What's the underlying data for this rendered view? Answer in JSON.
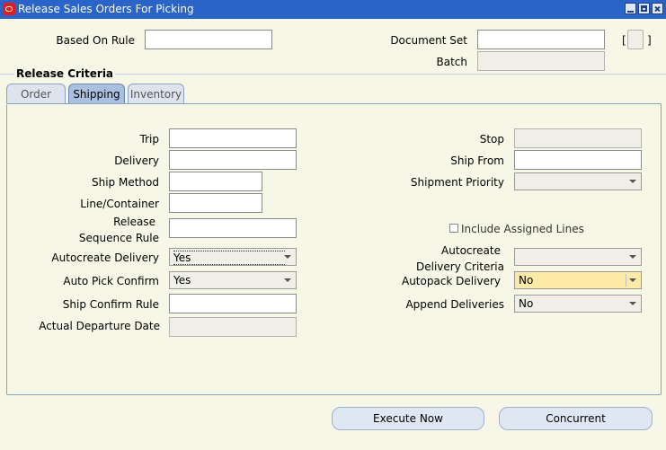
{
  "window": {
    "title": "Release Sales Orders For Picking"
  },
  "header": {
    "based_on_rule_label": "Based On Rule",
    "based_on_rule_value": "",
    "document_set_label": "Document Set",
    "document_set_value": "",
    "batch_label": "Batch",
    "batch_value": "",
    "bracket_left": "[",
    "bracket_right": "]"
  },
  "release_criteria": {
    "title": "Release Criteria",
    "tabs": [
      {
        "label": "Order"
      },
      {
        "label": "Shipping"
      },
      {
        "label": "Inventory"
      }
    ],
    "active_tab": "Shipping"
  },
  "shipping": {
    "trip_label": "Trip",
    "delivery_label": "Delivery",
    "ship_method_label": "Ship Method",
    "line_container_label": "Line/Container",
    "release_label": "Release",
    "sequence_rule_label": "Sequence Rule",
    "autocreate_delivery_label": "Autocreate Delivery",
    "autocreate_delivery_value": "Yes",
    "auto_pick_confirm_label": "Auto Pick Confirm",
    "auto_pick_confirm_value": "Yes",
    "ship_confirm_rule_label": "Ship Confirm Rule",
    "actual_departure_date_label": "Actual Departure Date",
    "stop_label": "Stop",
    "ship_from_label": "Ship From",
    "shipment_priority_label": "Shipment Priority",
    "shipment_priority_value": "",
    "include_assigned_lines_label": "Include Assigned Lines",
    "autocreate_label": "Autocreate",
    "delivery_criteria_label": "Delivery Criteria",
    "autocreate_criteria_value": "",
    "autopack_delivery_label": "Autopack Delivery",
    "autopack_delivery_value": "No",
    "append_deliveries_label": "Append Deliveries",
    "append_deliveries_value": "No"
  },
  "buttons": {
    "execute_now": "Execute Now",
    "concurrent": "Concurrent"
  },
  "colors": {
    "titlebar": "#2a64c8",
    "background": "#f7f7e7",
    "highlight_field": "#fdeaa6"
  }
}
